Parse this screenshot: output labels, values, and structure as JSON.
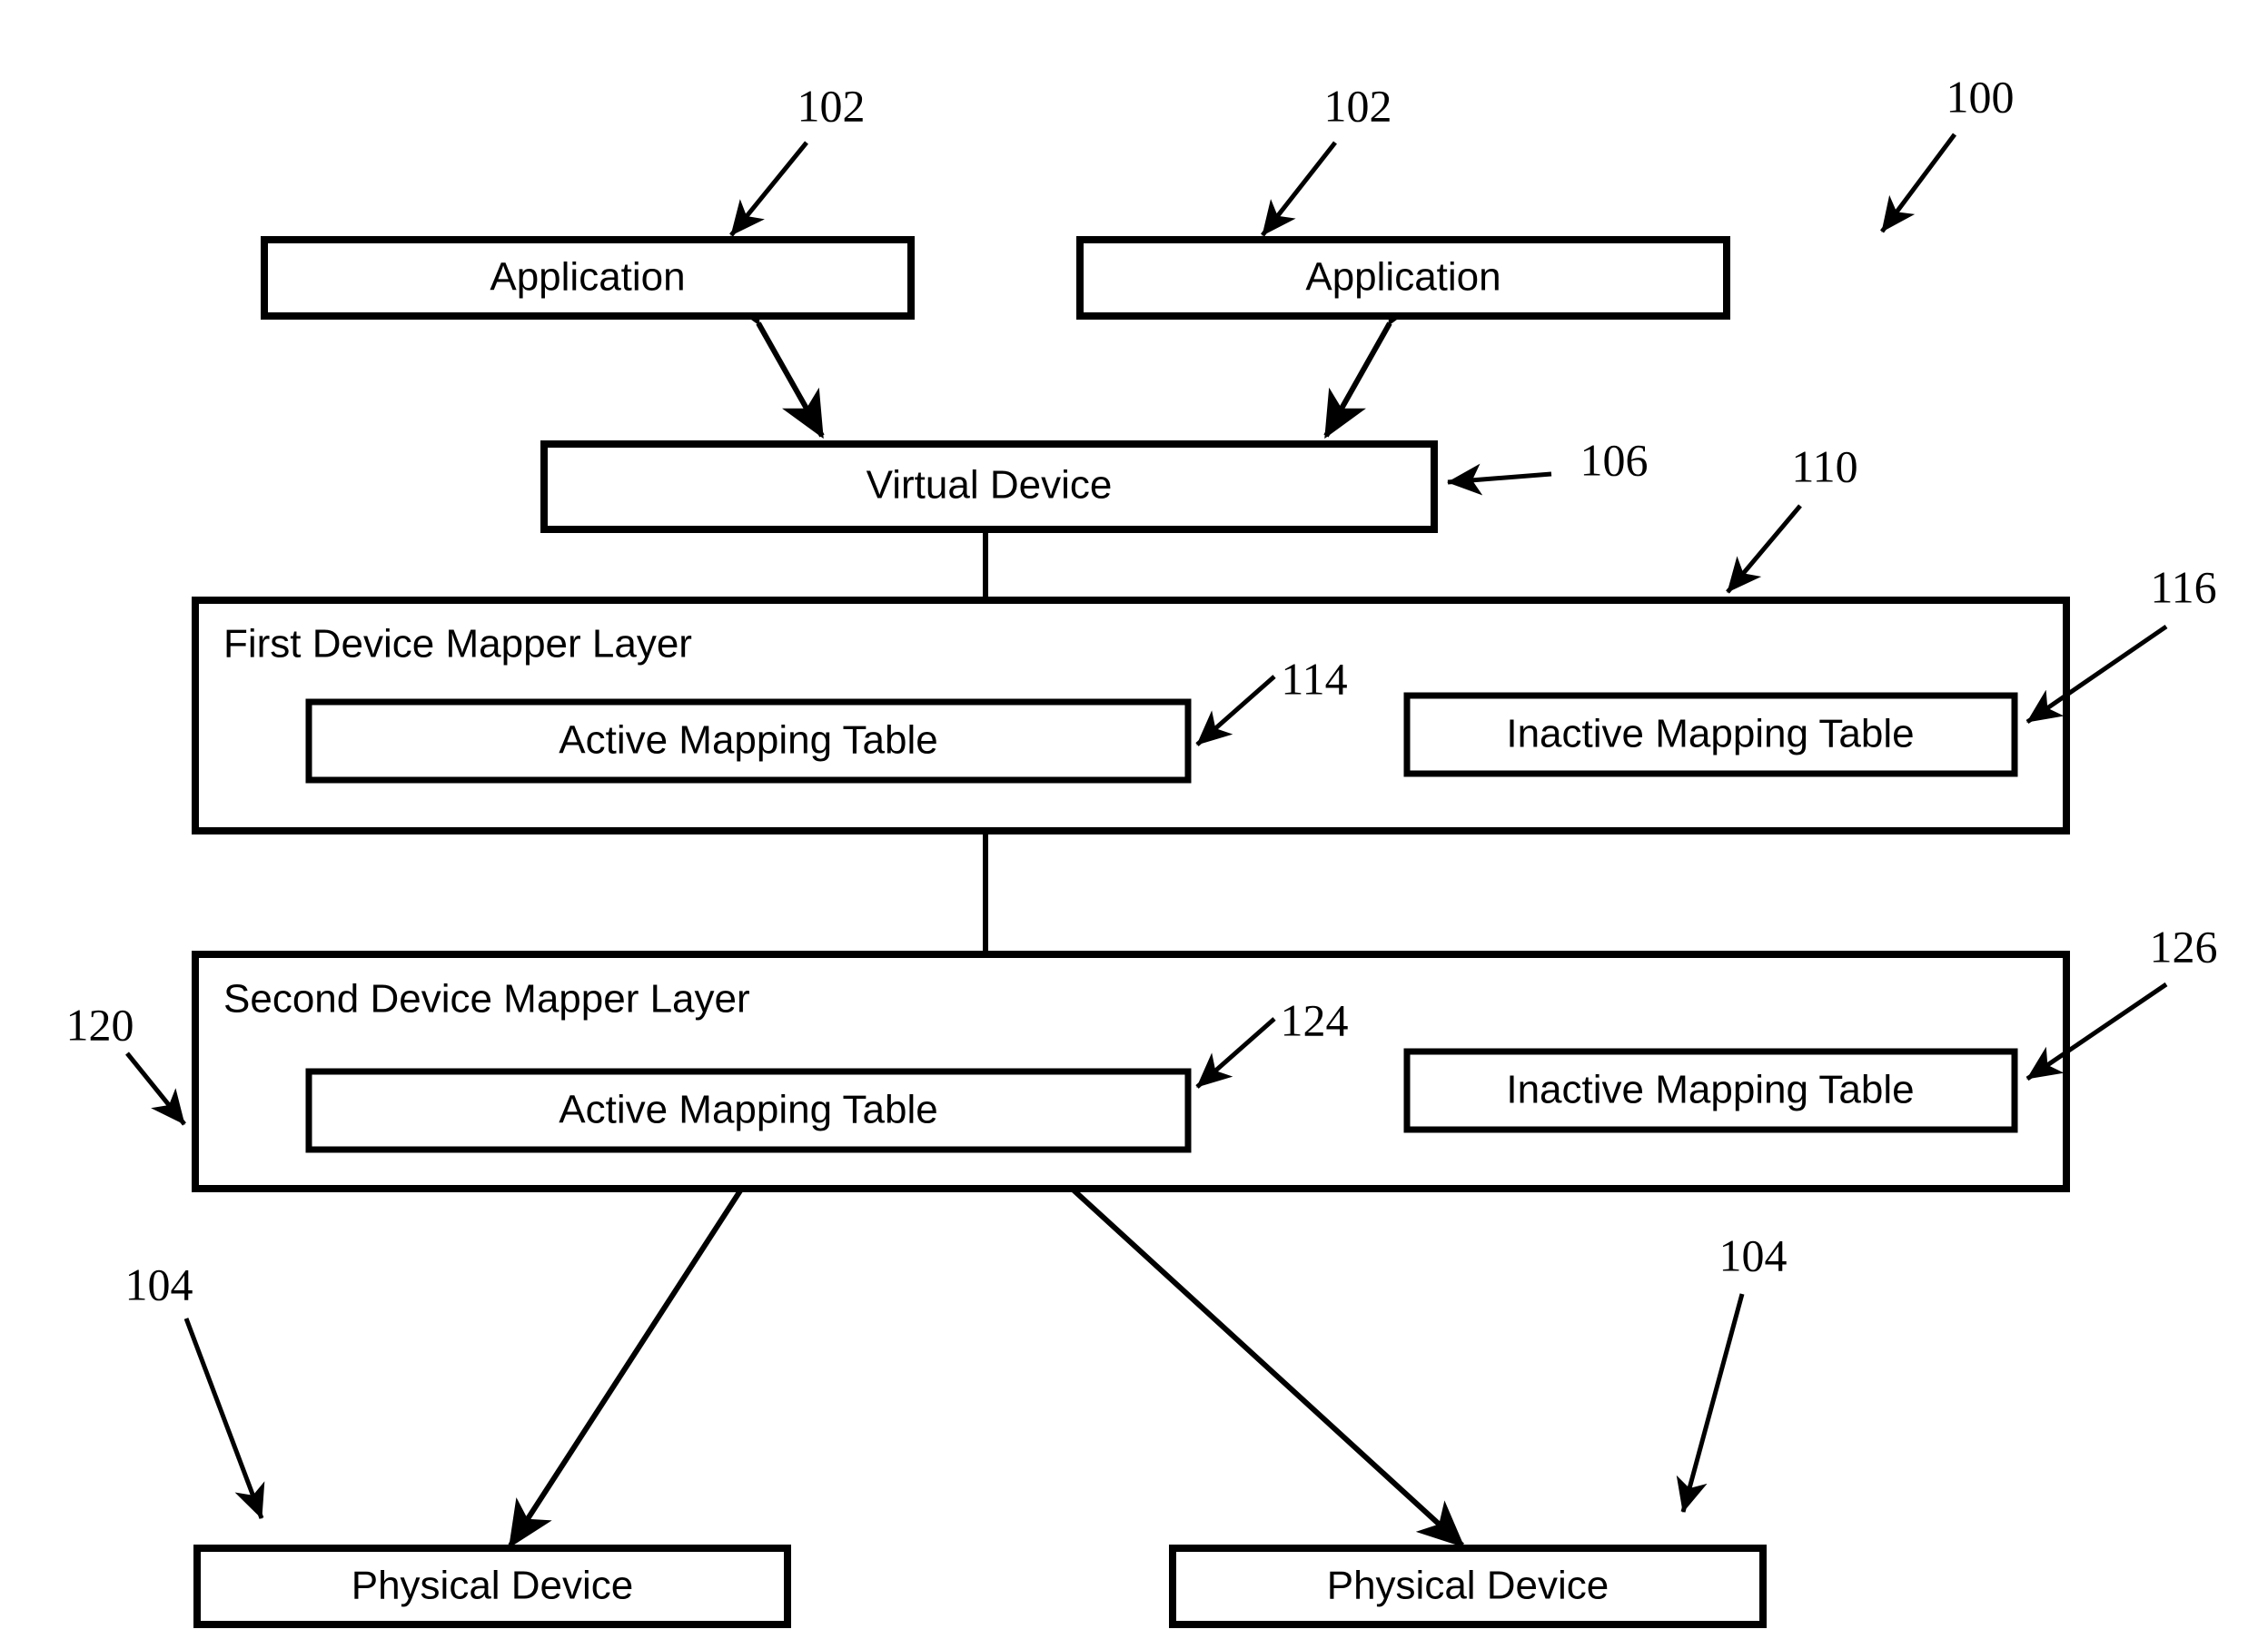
{
  "figure": {
    "type": "patent-block-diagram",
    "background_color": "#ffffff",
    "line_color": "#000000",
    "overall_reference": "100"
  },
  "nodes": {
    "application_left": {
      "label": "Application"
    },
    "application_right": {
      "label": "Application"
    },
    "virtual_device": {
      "label": "Virtual Device"
    },
    "first_layer": {
      "title": "First Device Mapper Layer",
      "active_table": "Active Mapping Table",
      "inactive_table": "Inactive Mapping Table"
    },
    "second_layer": {
      "title": "Second Device Mapper Layer",
      "active_table": "Active Mapping Table",
      "inactive_table": "Inactive Mapping Table"
    },
    "physical_device_left": {
      "label": "Physical Device"
    },
    "physical_device_right": {
      "label": "Physical Device"
    }
  },
  "reference_numerals": {
    "overall": "100",
    "application_left": "102",
    "application_right": "102",
    "physical_device_left": "104",
    "physical_device_right": "104",
    "virtual_device": "106",
    "first_layer": "110",
    "first_active_table": "114",
    "first_inactive_table": "116",
    "second_layer": "120",
    "second_active_table": "124",
    "second_inactive_table": "126"
  }
}
